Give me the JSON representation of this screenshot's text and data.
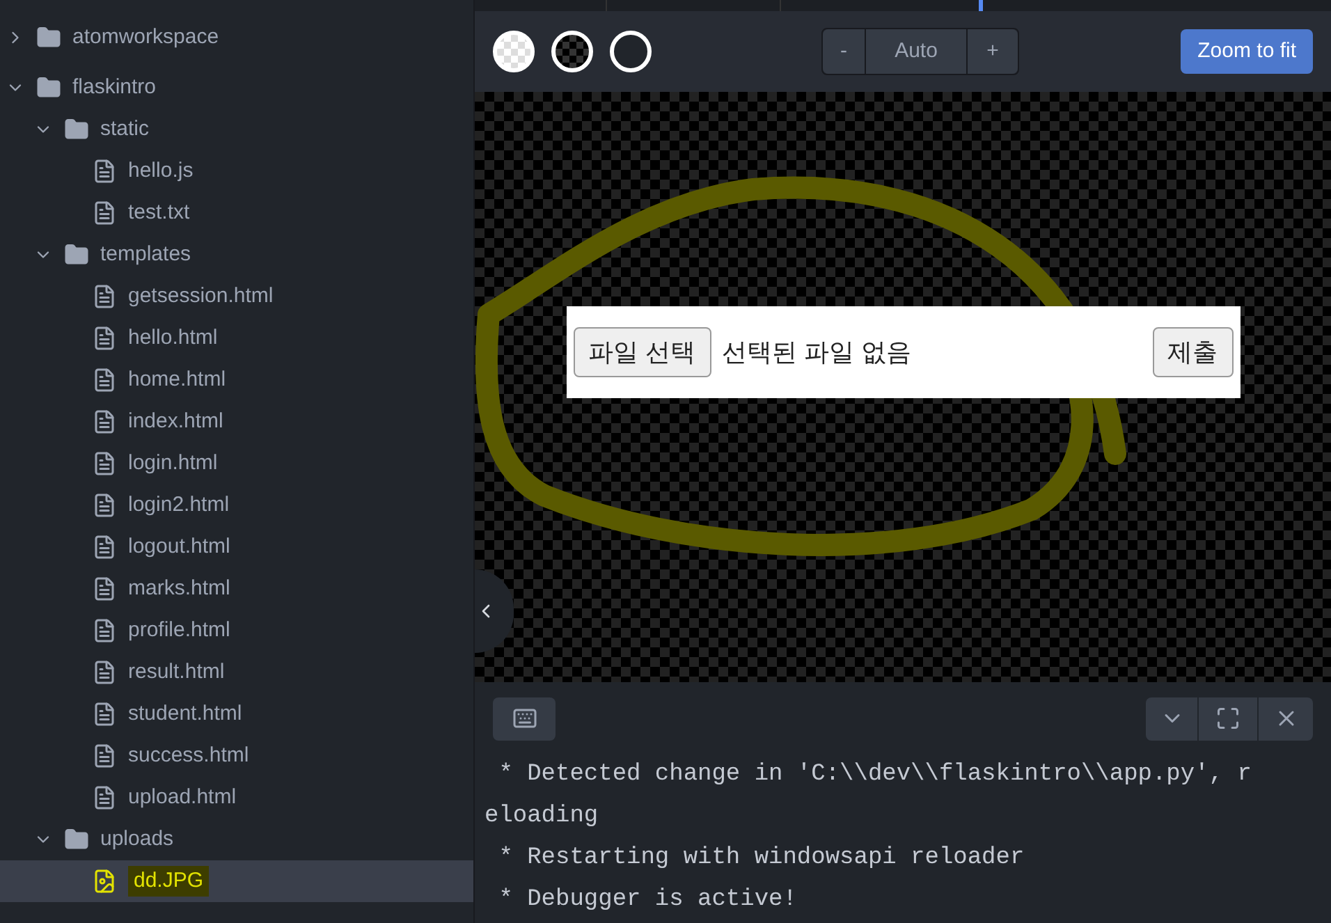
{
  "tree": [
    {
      "name": "atomworkspace",
      "kind": "folder",
      "expanded": false,
      "selected": false
    },
    {
      "name": "flaskintro",
      "kind": "folder",
      "expanded": true,
      "selected": false,
      "children": [
        {
          "name": "static",
          "kind": "folder",
          "expanded": true,
          "selected": false,
          "children": [
            {
              "name": "hello.js",
              "kind": "file",
              "selected": false
            },
            {
              "name": "test.txt",
              "kind": "file",
              "selected": false
            }
          ]
        },
        {
          "name": "templates",
          "kind": "folder",
          "expanded": true,
          "selected": false,
          "children": [
            {
              "name": "getsession.html",
              "kind": "file",
              "selected": false
            },
            {
              "name": "hello.html",
              "kind": "file",
              "selected": false
            },
            {
              "name": "home.html",
              "kind": "file",
              "selected": false
            },
            {
              "name": "index.html",
              "kind": "file",
              "selected": false
            },
            {
              "name": "login.html",
              "kind": "file",
              "selected": false
            },
            {
              "name": "login2.html",
              "kind": "file",
              "selected": false
            },
            {
              "name": "logout.html",
              "kind": "file",
              "selected": false
            },
            {
              "name": "marks.html",
              "kind": "file",
              "selected": false
            },
            {
              "name": "profile.html",
              "kind": "file",
              "selected": false
            },
            {
              "name": "result.html",
              "kind": "file",
              "selected": false
            },
            {
              "name": "student.html",
              "kind": "file",
              "selected": false
            },
            {
              "name": "success.html",
              "kind": "file",
              "selected": false
            },
            {
              "name": "upload.html",
              "kind": "file",
              "selected": false
            }
          ]
        },
        {
          "name": "uploads",
          "kind": "folder",
          "expanded": true,
          "selected": false,
          "children": [
            {
              "name": "dd.JPG",
              "kind": "image",
              "selected": true
            }
          ]
        }
      ]
    }
  ],
  "toolbar": {
    "backgrounds": [
      {
        "kind": "light-checker"
      },
      {
        "kind": "dark-checker"
      },
      {
        "kind": "plain"
      }
    ],
    "zoom": {
      "minus": "-",
      "value": "Auto",
      "plus": "+"
    },
    "fit_button": "Zoom to fit"
  },
  "preview": {
    "file_button": "파일 선택",
    "file_status": "선택된 파일 없음",
    "submit_button": "제출"
  },
  "terminal": {
    "lines": [
      " * Detected change in 'C:\\\\dev\\\\flaskintro\\\\app.py', r",
      "eloading",
      " * Restarting with windowsapi reloader",
      " * Debugger is active!"
    ]
  }
}
